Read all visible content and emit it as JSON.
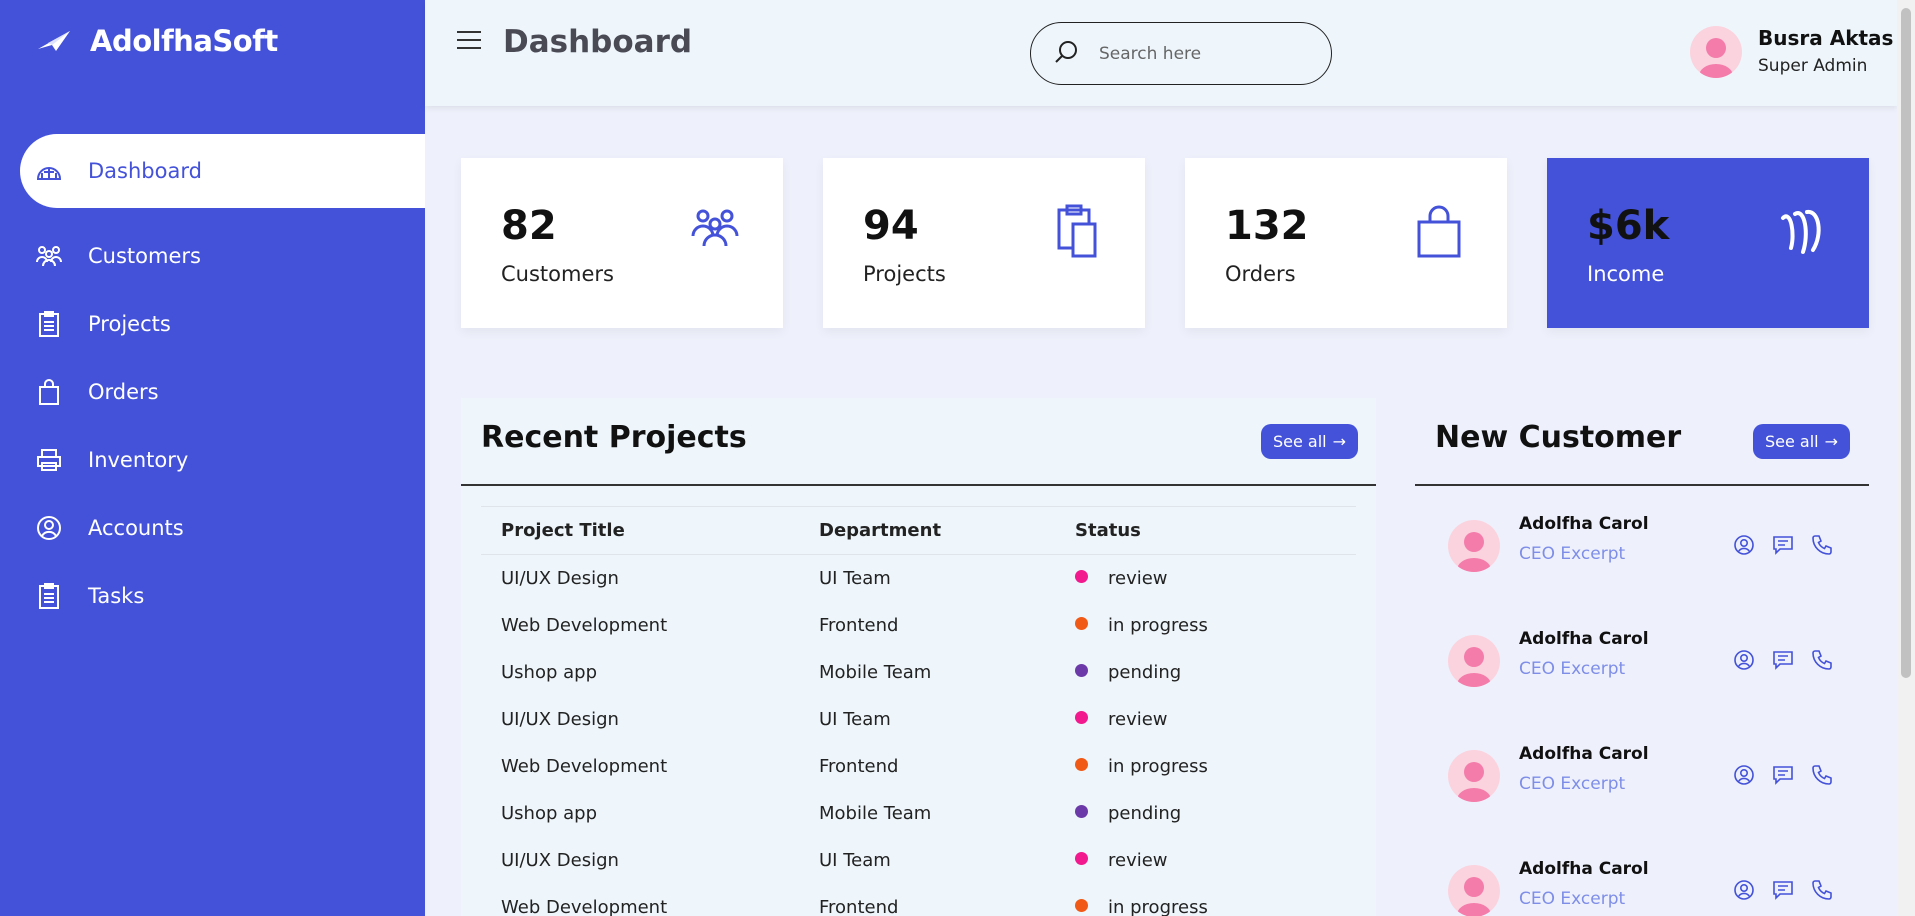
{
  "brand": {
    "name": "AdolfhaSoft",
    "logo_icon": "paper-plane-icon"
  },
  "sidebar": {
    "items": [
      {
        "label": "Dashboard",
        "icon": "dashboard-gauge-icon",
        "active": true
      },
      {
        "label": "Customers",
        "icon": "people-icon"
      },
      {
        "label": "Projects",
        "icon": "clipboard-icon"
      },
      {
        "label": "Orders",
        "icon": "shopping-bag-icon"
      },
      {
        "label": "Inventory",
        "icon": "printer-icon"
      },
      {
        "label": "Accounts",
        "icon": "user-circle-icon"
      },
      {
        "label": "Tasks",
        "icon": "clipboard-list-icon"
      }
    ]
  },
  "header": {
    "title": "Dashboard",
    "search_placeholder": "Search here",
    "user": {
      "name": "Busra Aktas",
      "role": "Super Admin"
    }
  },
  "cards": [
    {
      "value": "82",
      "label": "Customers",
      "icon": "people-icon"
    },
    {
      "value": "94",
      "label": "Projects",
      "icon": "clipboard-icon"
    },
    {
      "value": "132",
      "label": "Orders",
      "icon": "shopping-bag-icon"
    },
    {
      "value": "$6k",
      "label": "Income",
      "icon": "money-icon"
    }
  ],
  "recent_projects": {
    "title": "Recent Projects",
    "see_all": "See all",
    "columns": [
      "Project Title",
      "Department",
      "Status"
    ],
    "rows": [
      [
        "UI/UX Design",
        "UI Team",
        "review"
      ],
      [
        "Web Development",
        "Frontend",
        "in progress"
      ],
      [
        "Ushop app",
        "Mobile Team",
        "pending"
      ],
      [
        "UI/UX Design",
        "UI Team",
        "review"
      ],
      [
        "Web Development",
        "Frontend",
        "in progress"
      ],
      [
        "Ushop app",
        "Mobile Team",
        "pending"
      ],
      [
        "UI/UX Design",
        "UI Team",
        "review"
      ],
      [
        "Web Development",
        "Frontend",
        "in progress"
      ]
    ],
    "status_colors": {
      "review": "#f1198d",
      "in progress": "#f15a16",
      "pending": "#6c3aa8"
    }
  },
  "new_customer": {
    "title": "New Customer",
    "see_all": "See all",
    "items": [
      {
        "name": "Adolfha Carol",
        "role": "CEO Excerpt"
      },
      {
        "name": "Adolfha Carol",
        "role": "CEO Excerpt"
      },
      {
        "name": "Adolfha Carol",
        "role": "CEO Excerpt"
      },
      {
        "name": "Adolfha Carol",
        "role": "CEO Excerpt"
      }
    ]
  },
  "colors": {
    "accent": "#4352d9",
    "sidebar_bg": "#4352d9",
    "link": "#7e8ee8"
  }
}
